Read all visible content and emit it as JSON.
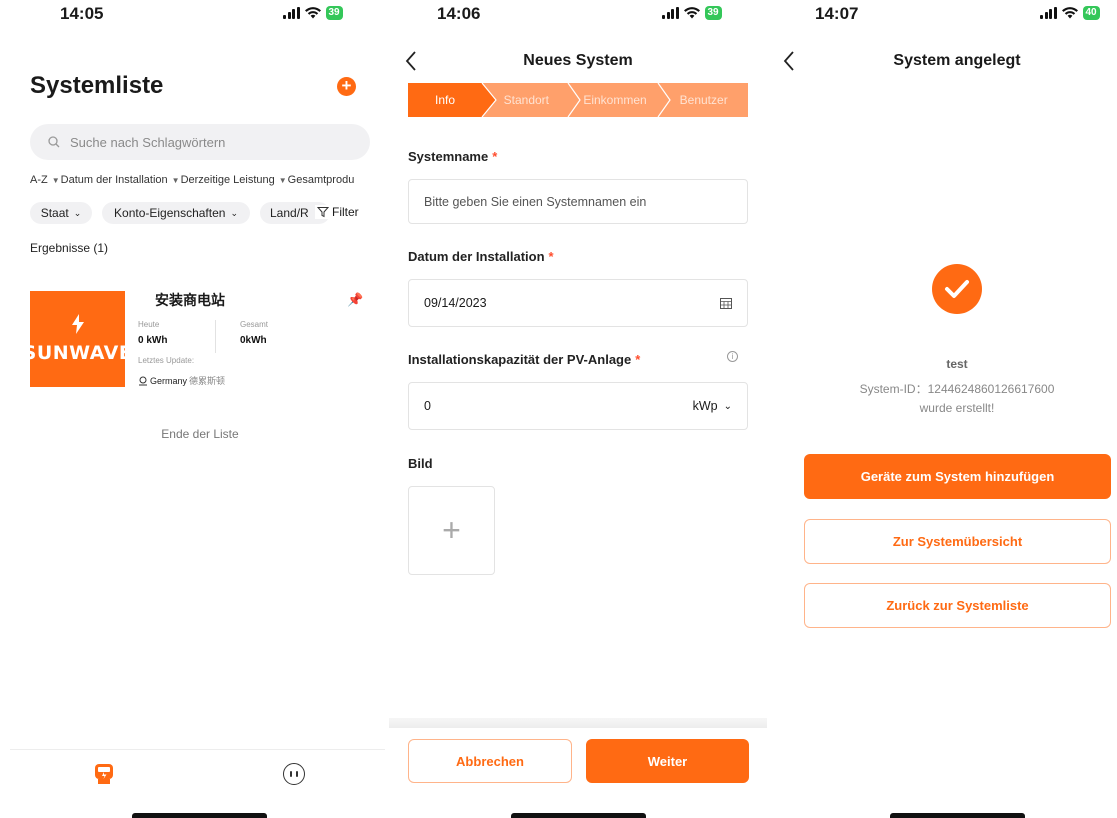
{
  "screen1": {
    "status": {
      "time": "14:05",
      "battery": "39"
    },
    "title": "Systemliste",
    "search_placeholder": "Suche nach Schlagwörtern",
    "sort_options": [
      "A-Z",
      "Datum der Installation",
      "Derzeitige Leistung",
      "Gesamtprodu"
    ],
    "filters": [
      "Staat",
      "Konto-Eigenschaften",
      "Land/R"
    ],
    "filter_label": "Filter",
    "results_label": "Ergebnisse  (1)",
    "plant": {
      "logo_text": "SUNWAVE",
      "name": "安装商电站",
      "today_label": "Heute",
      "today_value": "0 kWh",
      "total_label": "Gesamt",
      "total_value": "0kWh",
      "last_update_label": "Letztes Update:",
      "country": "Germany",
      "region": "德累斯顿"
    },
    "end_of_list": "Ende der Liste",
    "tabs": [
      "plant-tab-icon",
      "service-tab-icon"
    ]
  },
  "screen2": {
    "status": {
      "time": "14:06",
      "battery": "39"
    },
    "title": "Neues System",
    "steps": [
      "Info",
      "Standort",
      "Einkommen",
      "Benutzer"
    ],
    "system_name_label": "Systemname",
    "system_name_placeholder": "Bitte geben Sie einen Systemnamen ein",
    "install_date_label": "Datum der Installation",
    "install_date_value": "09/14/2023",
    "capacity_label": "Installationskapazität der PV-Anlage",
    "capacity_value": "0",
    "capacity_unit": "kWp",
    "image_label": "Bild",
    "cancel_label": "Abbrechen",
    "next_label": "Weiter"
  },
  "screen3": {
    "status": {
      "time": "14:07",
      "battery": "40"
    },
    "title": "System angelegt",
    "system_name": "test",
    "system_id": "System-ID：1244624860126617600",
    "created_text": "wurde erstellt!",
    "add_devices_label": "Geräte zum System hinzufügen",
    "overview_label": "Zur Systemübersicht",
    "back_list_label": "Zurück zur Systemliste"
  },
  "colors": {
    "accent": "#ff6a13",
    "accent_light": "#ffa06b",
    "battery": "#34c759"
  }
}
